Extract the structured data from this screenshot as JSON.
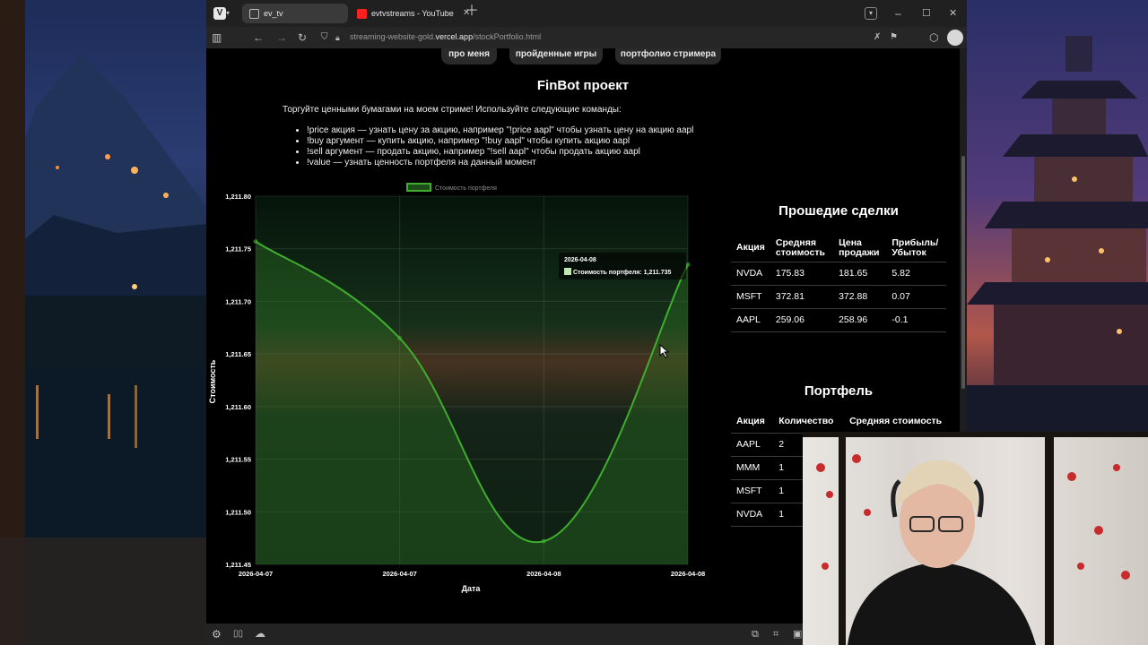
{
  "browser": {
    "tabs": [
      {
        "label": "ev_tv"
      },
      {
        "label": "evtvstreams - YouTube"
      }
    ],
    "url_host": "streaming-website-gold.",
    "url_bold": "vercel.app",
    "url_path": "/stockPortfolio.html"
  },
  "nav": {
    "about": "про меня",
    "games": "пройденные игры",
    "portfolio": "портфолио стримера"
  },
  "page": {
    "title": "FinBot проект",
    "intro": "Торгуйте ценными бумагами на моем стриме! Используйте следующие команды:",
    "commands": [
      "!price акция — узнать цену за акцию, например \"!price aapl\" чтобы узнать цену на акцию aapl",
      "!buy аргумент — купить акцию, например \"!buy aapl\" чтобы купить акцию aapl",
      "!sell аргумент — продать акцию, например \"!sell aapl\" чтобы продать акцию aapl",
      "!value — узнать ценность портфеля на данный момент"
    ]
  },
  "chart_data": {
    "type": "line",
    "xlabel": "Дата",
    "ylabel": "Стоимость",
    "x": [
      "2026-04-07",
      "2026-04-07",
      "2026-04-08",
      "2026-04-08"
    ],
    "series": [
      {
        "name": "Стоимость портфеля",
        "values": [
          1211.757,
          1211.665,
          1211.472,
          1211.735
        ]
      }
    ],
    "ylim": [
      1211.45,
      1211.8
    ],
    "yticks": [
      "1,211.80",
      "1,211.75",
      "1,211.70",
      "1,211.65",
      "1,211.60",
      "1,211.55",
      "1,211.50",
      "1,211.45"
    ],
    "xticks": [
      "2026-04-07",
      "2026-04-07",
      "2026-04-08",
      "2026-04-08"
    ],
    "legend": "top",
    "grid": true,
    "fill": true,
    "tooltip": {
      "title": "2026-04-08",
      "text": "Стоимость портфеля: 1,211.735"
    },
    "color": "#3fae2e"
  },
  "trades": {
    "title": "Прошедие сделки",
    "headers": [
      "Акция",
      "Средняя стоимость",
      "Цена продажи",
      "Прибыль/ Убыток"
    ],
    "rows": [
      [
        "NVDA",
        "175.83",
        "181.65",
        "5.82"
      ],
      [
        "MSFT",
        "372.81",
        "372.88",
        "0.07"
      ],
      [
        "AAPL",
        "259.06",
        "258.96",
        "-0.1"
      ]
    ]
  },
  "portfolio": {
    "title": "Портфель",
    "headers": [
      "Акция",
      "Количество",
      "Средняя стоимость"
    ],
    "rows": [
      [
        "AAPL",
        "2"
      ],
      [
        "MMM",
        "1"
      ],
      [
        "MSFT",
        "1"
      ],
      [
        "NVDA",
        "1"
      ]
    ]
  }
}
